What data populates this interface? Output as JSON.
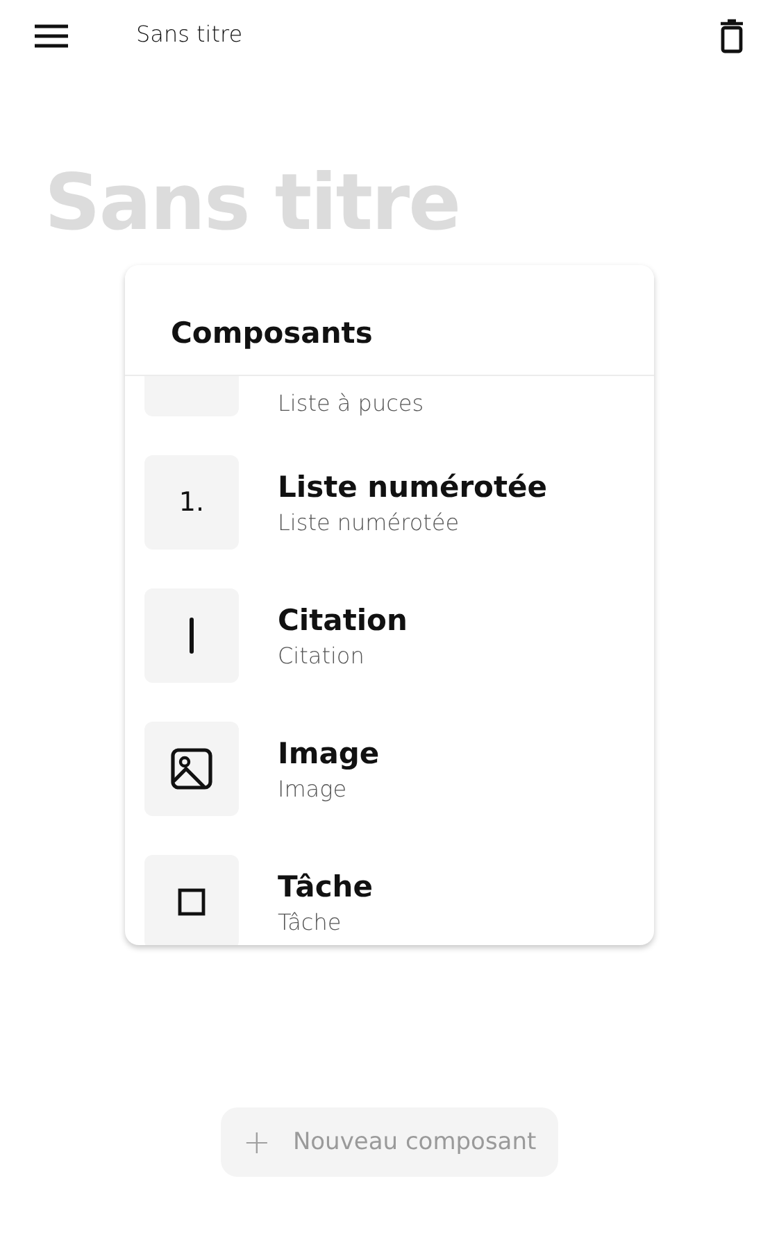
{
  "app_bar": {
    "title": "Sans titre"
  },
  "document": {
    "title_placeholder": "Sans titre"
  },
  "components_panel": {
    "title": "Composants",
    "items": [
      {
        "kind": "bullets",
        "subtitle": "Liste à puces"
      },
      {
        "kind": "numbered",
        "glyph": "1.",
        "title": "Liste numérotée",
        "subtitle": "Liste numérotée"
      },
      {
        "kind": "quote",
        "title": "Citation",
        "subtitle": "Citation"
      },
      {
        "kind": "image",
        "title": "Image",
        "subtitle": "Image"
      },
      {
        "kind": "task",
        "title": "Tâche",
        "subtitle": "Tâche"
      }
    ]
  },
  "new_component_button": {
    "icon": "+",
    "label": "Nouveau composant"
  }
}
